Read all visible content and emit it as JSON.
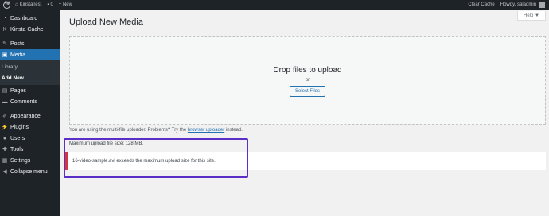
{
  "adminbar": {
    "site_name": "KinstaTest",
    "comments_count": "0",
    "new_label": "+ New",
    "clear_cache": "Clear Cache",
    "howdy": "Howdy, saladmin"
  },
  "sidebar": {
    "items": [
      {
        "label": "Dashboard",
        "icon": "dashboard-icon"
      },
      {
        "label": "Kinsta Cache",
        "icon": "kinsta-icon"
      },
      {
        "label": "Posts",
        "icon": "pin-icon"
      },
      {
        "label": "Media",
        "icon": "media-icon"
      },
      {
        "label": "Pages",
        "icon": "pages-icon"
      },
      {
        "label": "Comments",
        "icon": "comments-icon"
      },
      {
        "label": "Appearance",
        "icon": "brush-icon"
      },
      {
        "label": "Plugins",
        "icon": "plugin-icon"
      },
      {
        "label": "Users",
        "icon": "users-icon"
      },
      {
        "label": "Tools",
        "icon": "tools-icon"
      },
      {
        "label": "Settings",
        "icon": "settings-icon"
      },
      {
        "label": "Collapse menu",
        "icon": "collapse-icon"
      }
    ],
    "media_submenu": [
      "Library",
      "Add New"
    ]
  },
  "help_label": "Help ▼",
  "page_title": "Upload New Media",
  "dropzone": {
    "title": "Drop files to upload",
    "or": "or",
    "button": "Select Files"
  },
  "uploader_note": {
    "before": "You are using the multi-file uploader. Problems? Try the ",
    "link": "browser uploader",
    "after": " instead."
  },
  "max_size": "Maximum upload file size: 128 MB.",
  "error_message": "16-video-sample.avi exceeds the maximum upload size for this site.",
  "colors": {
    "accent": "#2271b1",
    "error": "#d63638",
    "highlight": "#5b2ec7"
  }
}
